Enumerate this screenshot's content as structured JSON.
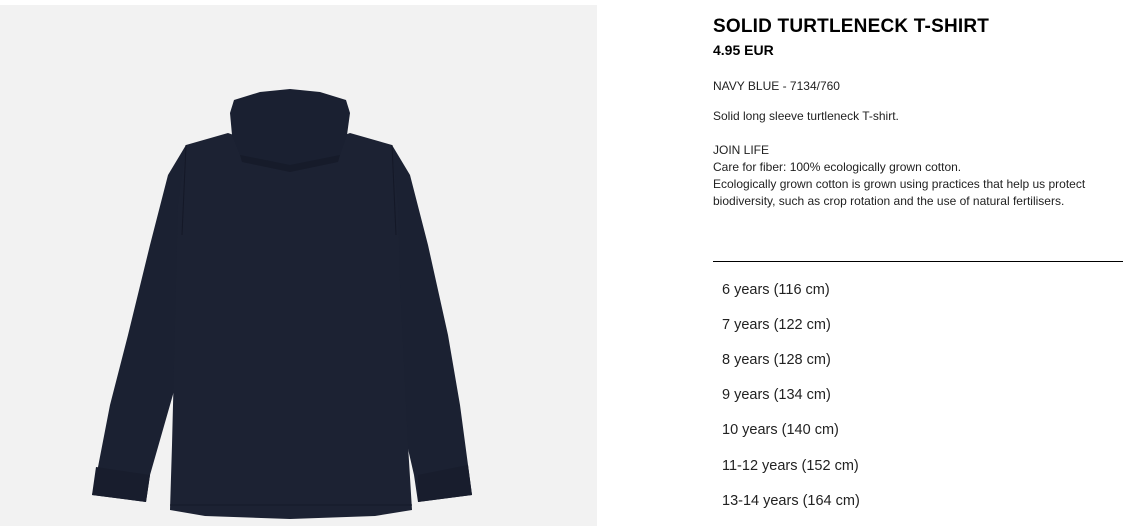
{
  "product": {
    "title": "SOLID TURTLENECK T-SHIRT",
    "price": "4.95 EUR",
    "color_ref": "NAVY BLUE - 7134/760",
    "description": "Solid long sleeve turtleneck T-shirt.",
    "care": {
      "heading": "JOIN LIFE",
      "fiber": "Care for fiber: 100% ecologically grown cotton.",
      "details": "Ecologically grown cotton is grown using practices that help us protect biodiversity, such as crop rotation and the use of natural fertilisers."
    },
    "garment_color": "#1c2233"
  },
  "sizes": [
    "6 years (116 cm)",
    "7 years (122 cm)",
    "8 years (128 cm)",
    "9 years (134 cm)",
    "10 years (140 cm)",
    "11-12 years (152 cm)",
    "13-14 years (164 cm)"
  ]
}
